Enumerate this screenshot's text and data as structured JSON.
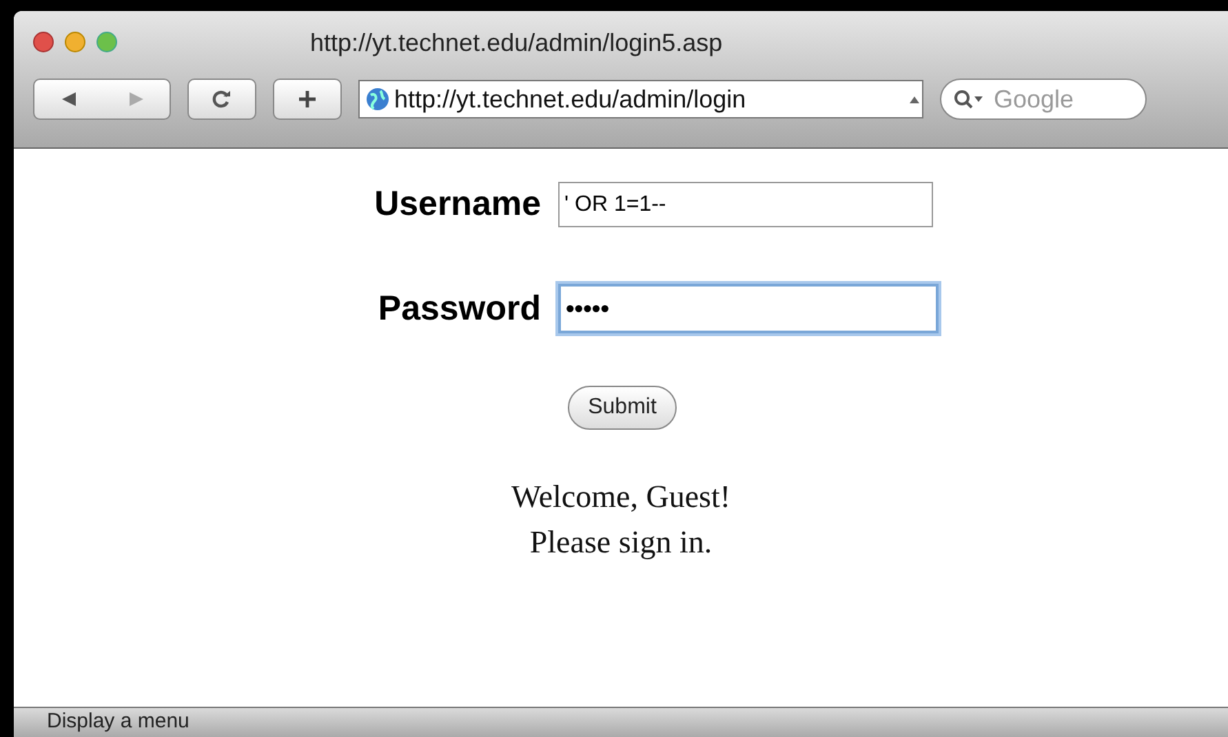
{
  "window": {
    "title": "http://yt.technet.edu/admin/login5.asp"
  },
  "toolbar": {
    "address": "http://yt.technet.edu/admin/login",
    "search": {
      "placeholder": "Google"
    }
  },
  "form": {
    "fields": [
      {
        "label": "Username",
        "value": "' OR 1=1--",
        "focused": false
      },
      {
        "label": "Password",
        "value": "•••••",
        "focused": true
      }
    ],
    "submit": "Submit"
  },
  "message": [
    "Welcome, Guest!",
    "Please sign in."
  ],
  "status_bar": "Display a menu"
}
